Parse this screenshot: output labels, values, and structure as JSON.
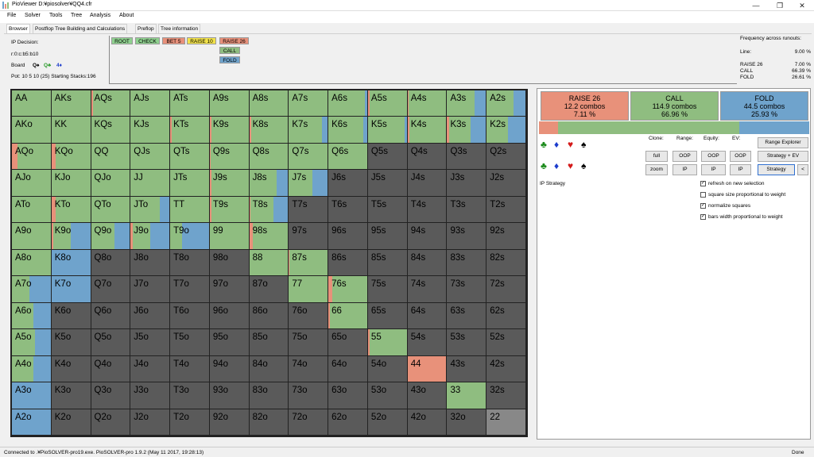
{
  "window": {
    "title": "PioViewer D:¥piosolver¥QQ4.cfr",
    "minimize": "—",
    "maximize": "❐",
    "close": "✕"
  },
  "menu": [
    "File",
    "Solver",
    "Tools",
    "Tree",
    "Analysis",
    "About"
  ],
  "tabs": [
    "Browser",
    "Postflop Tree Building and Calculations",
    "Preflop",
    "Tree information"
  ],
  "info": {
    "decision": "IP Decision:",
    "line": "r:0:c:b5:b10",
    "board_label": "Board",
    "board_cards": [
      {
        "text": "Q♠",
        "color": "#000000"
      },
      {
        "text": "Q♣",
        "color": "#2a9a2a"
      },
      {
        "text": "4♦",
        "color": "#1c3ccc"
      }
    ],
    "pot": "Pot: 10 5 10 (25) Starting Stacks:196"
  },
  "tree_buttons": [
    {
      "label": "ROOT",
      "color": "#8fd18f"
    },
    {
      "label": "CHECK",
      "color": "#8fd18f"
    },
    {
      "label": "BET 5",
      "color": "#e8907a"
    },
    {
      "label": "RAISE 10",
      "color": "#f2e24a"
    },
    {
      "label": "RAISE 26",
      "color": "#e8907a"
    },
    {
      "label": "CALL",
      "color": "#8fbd80"
    },
    {
      "label": "FOLD",
      "color": "#6fa3cc"
    }
  ],
  "frequency": {
    "title": "Frequency across runouts:",
    "line_label": "Line:",
    "line_value": "9.00 %",
    "rows": [
      {
        "label": "RAISE 26",
        "value": "7.00 %"
      },
      {
        "label": "CALL",
        "value": "66.39 %"
      },
      {
        "label": "FOLD",
        "value": "26.61 %"
      }
    ]
  },
  "colors": {
    "raise": "#e8917a",
    "call": "#8fbd80",
    "fold": "#6fa3cc",
    "empty": "#5a5a5a",
    "pair22": "#888888"
  },
  "grid": {
    "rows": [
      [
        "AA",
        "AKs",
        "AQs",
        "AJs",
        "ATs",
        "A9s",
        "A8s",
        "A7s",
        "A6s",
        "A5s",
        "A4s",
        "A3s",
        "A2s"
      ],
      [
        "AKo",
        "KK",
        "KQs",
        "KJs",
        "KTs",
        "K9s",
        "K8s",
        "K7s",
        "K6s",
        "K5s",
        "K4s",
        "K3s",
        "K2s"
      ],
      [
        "AQo",
        "KQo",
        "QQ",
        "QJs",
        "QTs",
        "Q9s",
        "Q8s",
        "Q7s",
        "Q6s",
        "Q5s",
        "Q4s",
        "Q3s",
        "Q2s"
      ],
      [
        "AJo",
        "KJo",
        "QJo",
        "JJ",
        "JTs",
        "J9s",
        "J8s",
        "J7s",
        "J6s",
        "J5s",
        "J4s",
        "J3s",
        "J2s"
      ],
      [
        "ATo",
        "KTo",
        "QTo",
        "JTo",
        "TT",
        "T9s",
        "T8s",
        "T7s",
        "T6s",
        "T5s",
        "T4s",
        "T3s",
        "T2s"
      ],
      [
        "A9o",
        "K9o",
        "Q9o",
        "J9o",
        "T9o",
        "99",
        "98s",
        "97s",
        "96s",
        "95s",
        "94s",
        "93s",
        "92s"
      ],
      [
        "A8o",
        "K8o",
        "Q8o",
        "J8o",
        "T8o",
        "98o",
        "88",
        "87s",
        "86s",
        "85s",
        "84s",
        "83s",
        "82s"
      ],
      [
        "A7o",
        "K7o",
        "Q7o",
        "J7o",
        "T7o",
        "97o",
        "87o",
        "77",
        "76s",
        "75s",
        "74s",
        "73s",
        "72s"
      ],
      [
        "A6o",
        "K6o",
        "Q6o",
        "J6o",
        "T6o",
        "96o",
        "86o",
        "76o",
        "66",
        "65s",
        "64s",
        "63s",
        "62s"
      ],
      [
        "A5o",
        "K5o",
        "Q5o",
        "J5o",
        "T5o",
        "95o",
        "85o",
        "75o",
        "65o",
        "55",
        "54s",
        "53s",
        "52s"
      ],
      [
        "A4o",
        "K4o",
        "Q4o",
        "J4o",
        "T4o",
        "94o",
        "84o",
        "74o",
        "64o",
        "54o",
        "44",
        "43s",
        "42s"
      ],
      [
        "A3o",
        "K3o",
        "Q3o",
        "J3o",
        "T3o",
        "93o",
        "83o",
        "73o",
        "63o",
        "53o",
        "43o",
        "33",
        "32s"
      ],
      [
        "A2o",
        "K2o",
        "Q2o",
        "J2o",
        "T2o",
        "92o",
        "82o",
        "72o",
        "62o",
        "52o",
        "42o",
        "32o",
        "22"
      ]
    ],
    "strategy": [
      [
        [
          0,
          1,
          0
        ],
        [
          0,
          1,
          0
        ],
        [
          0.05,
          0.95,
          0
        ],
        [
          0,
          1,
          0
        ],
        [
          0,
          1,
          0
        ],
        [
          0,
          1,
          0
        ],
        [
          0,
          1,
          0
        ],
        [
          0,
          1,
          0
        ],
        [
          0,
          0.95,
          0.05
        ],
        [
          0.05,
          0.95,
          0
        ],
        [
          0.02,
          0.98,
          0
        ],
        [
          0,
          0.7,
          0.3
        ],
        [
          0,
          0.7,
          0.3
        ]
      ],
      [
        [
          0,
          1,
          0
        ],
        [
          0,
          1,
          0
        ],
        [
          0,
          1,
          0
        ],
        [
          0,
          1,
          0
        ],
        [
          0.03,
          0.97,
          0
        ],
        [
          0.05,
          0.95,
          0
        ],
        [
          0.05,
          0.95,
          0
        ],
        [
          0,
          0.85,
          0.15
        ],
        [
          0,
          0.9,
          0.1
        ],
        [
          0,
          0.95,
          0.05
        ],
        [
          0.05,
          0.95,
          0
        ],
        [
          0.05,
          0.55,
          0.4
        ],
        [
          0,
          0.55,
          0.45
        ]
      ],
      [
        [
          0.15,
          0.85,
          0
        ],
        [
          0.1,
          0.9,
          0
        ],
        [
          0,
          1,
          0
        ],
        [
          0,
          1,
          0
        ],
        [
          0,
          1,
          0
        ],
        [
          0.03,
          0.97,
          0
        ],
        [
          0,
          1,
          0
        ],
        [
          0,
          1,
          0
        ],
        [
          0,
          1,
          0
        ],
        [
          0,
          0,
          0
        ],
        [
          0,
          0,
          0
        ],
        [
          0,
          0,
          0
        ],
        [
          0,
          0,
          0
        ]
      ],
      [
        [
          0,
          1,
          0
        ],
        [
          0,
          1,
          0
        ],
        [
          0,
          1,
          0
        ],
        [
          0,
          1,
          0
        ],
        [
          0,
          1,
          0
        ],
        [
          0.05,
          0.95,
          0
        ],
        [
          0,
          0.7,
          0.3
        ],
        [
          0,
          0.6,
          0.4
        ],
        [
          0,
          0,
          0
        ],
        [
          0,
          0,
          0
        ],
        [
          0,
          0,
          0
        ],
        [
          0,
          0,
          0
        ],
        [
          0,
          0,
          0
        ]
      ],
      [
        [
          0,
          1,
          0
        ],
        [
          0.1,
          0.9,
          0
        ],
        [
          0,
          1,
          0
        ],
        [
          0,
          0.75,
          0.25
        ],
        [
          0,
          1,
          0
        ],
        [
          0.05,
          0.95,
          0
        ],
        [
          0.02,
          0.6,
          0.38
        ],
        [
          0,
          0,
          0
        ],
        [
          0,
          0,
          0
        ],
        [
          0,
          0,
          0
        ],
        [
          0,
          0,
          0
        ],
        [
          0,
          0,
          0
        ],
        [
          0,
          0,
          0
        ]
      ],
      [
        [
          0,
          1,
          0
        ],
        [
          0.05,
          0.45,
          0.5
        ],
        [
          0,
          0.6,
          0.4
        ],
        [
          0.05,
          0.45,
          0.5
        ],
        [
          0,
          0.3,
          0.7
        ],
        [
          0,
          1,
          0
        ],
        [
          0.1,
          0.9,
          0
        ],
        [
          0,
          0,
          0
        ],
        [
          0,
          0,
          0
        ],
        [
          0,
          0,
          0
        ],
        [
          0,
          0,
          0
        ],
        [
          0,
          0,
          0
        ],
        [
          0,
          0,
          0
        ]
      ],
      [
        [
          0,
          1,
          0
        ],
        [
          0,
          0,
          1
        ],
        [
          0,
          0,
          0
        ],
        [
          0,
          0,
          0
        ],
        [
          0,
          0,
          0
        ],
        [
          0,
          0,
          0
        ],
        [
          0,
          1,
          0
        ],
        [
          0.02,
          0.98,
          0
        ],
        [
          0,
          0,
          0
        ],
        [
          0,
          0,
          0
        ],
        [
          0,
          0,
          0
        ],
        [
          0,
          0,
          0
        ],
        [
          0,
          0,
          0
        ]
      ],
      [
        [
          0,
          0.45,
          0.55
        ],
        [
          0,
          0,
          1
        ],
        [
          0,
          0,
          0
        ],
        [
          0,
          0,
          0
        ],
        [
          0,
          0,
          0
        ],
        [
          0,
          0,
          0
        ],
        [
          0,
          0,
          0
        ],
        [
          0,
          1,
          0
        ],
        [
          0.1,
          0.9,
          0
        ],
        [
          0,
          0,
          0
        ],
        [
          0,
          0,
          0
        ],
        [
          0,
          0,
          0
        ],
        [
          0,
          0,
          0
        ]
      ],
      [
        [
          0,
          0.55,
          0.45
        ],
        [
          0,
          0,
          0
        ],
        [
          0,
          0,
          0
        ],
        [
          0,
          0,
          0
        ],
        [
          0,
          0,
          0
        ],
        [
          0,
          0,
          0
        ],
        [
          0,
          0,
          0
        ],
        [
          0,
          0,
          0
        ],
        [
          0.04,
          0.96,
          0
        ],
        [
          0,
          0,
          0
        ],
        [
          0,
          0,
          0
        ],
        [
          0,
          0,
          0
        ],
        [
          0,
          0,
          0
        ]
      ],
      [
        [
          0,
          0.6,
          0.4
        ],
        [
          0,
          0,
          0
        ],
        [
          0,
          0,
          0
        ],
        [
          0,
          0,
          0
        ],
        [
          0,
          0,
          0
        ],
        [
          0,
          0,
          0
        ],
        [
          0,
          0,
          0
        ],
        [
          0,
          0,
          0
        ],
        [
          0,
          0,
          0
        ],
        [
          0.04,
          0.96,
          0
        ],
        [
          0,
          0,
          0
        ],
        [
          0,
          0,
          0
        ],
        [
          0,
          0,
          0
        ]
      ],
      [
        [
          0,
          0.55,
          0.45
        ],
        [
          0,
          0,
          0
        ],
        [
          0,
          0,
          0
        ],
        [
          0,
          0,
          0
        ],
        [
          0,
          0,
          0
        ],
        [
          0,
          0,
          0
        ],
        [
          0,
          0,
          0
        ],
        [
          0,
          0,
          0
        ],
        [
          0,
          0,
          0
        ],
        [
          0,
          0,
          0
        ],
        [
          1,
          0,
          0
        ],
        [
          0,
          0,
          0
        ],
        [
          0,
          0,
          0
        ]
      ],
      [
        [
          0,
          0,
          1
        ],
        [
          0,
          0,
          0
        ],
        [
          0,
          0,
          0
        ],
        [
          0,
          0,
          0
        ],
        [
          0,
          0,
          0
        ],
        [
          0,
          0,
          0
        ],
        [
          0,
          0,
          0
        ],
        [
          0,
          0,
          0
        ],
        [
          0,
          0,
          0
        ],
        [
          0,
          0,
          0
        ],
        [
          0,
          0,
          0
        ],
        [
          0,
          1,
          0
        ],
        [
          0,
          0,
          0
        ]
      ],
      [
        [
          0,
          0,
          1
        ],
        [
          0,
          0,
          0
        ],
        [
          0,
          0,
          0
        ],
        [
          0,
          0,
          0
        ],
        [
          0,
          0,
          0
        ],
        [
          0,
          0,
          0
        ],
        [
          0,
          0,
          0
        ],
        [
          0,
          0,
          0
        ],
        [
          0,
          0,
          0
        ],
        [
          0,
          0,
          0
        ],
        [
          0,
          0,
          0
        ],
        [
          0,
          0,
          0
        ],
        [
          0,
          0,
          0
        ]
      ]
    ]
  },
  "actions": [
    {
      "name": "RAISE 26",
      "combos": "12.2 combos",
      "pct": "7.11 %",
      "color": "#e8917a"
    },
    {
      "name": "CALL",
      "combos": "114.9 combos",
      "pct": "66.96 %",
      "color": "#8fbd80"
    },
    {
      "name": "FOLD",
      "combos": "44.5 combos",
      "pct": "25.93 %",
      "color": "#6fa3cc"
    }
  ],
  "freq_bar": [
    0.0711,
    0.6696,
    0.2593
  ],
  "suits": [
    {
      "g": "♣",
      "c": "#1a8a1a"
    },
    {
      "g": "♦",
      "c": "#1c3ccc"
    },
    {
      "g": "♥",
      "c": "#d41a1a"
    },
    {
      "g": "♠",
      "c": "#000000"
    }
  ],
  "controls": {
    "clone": "Clone:",
    "range": "Range:",
    "equity": "Equity:",
    "ev": "EV:",
    "full": "full",
    "zoom": "zoom",
    "oop": "OOP",
    "ip": "IP",
    "range_explorer": "Range Explorer",
    "strategy_ev": "Strategy + EV",
    "strategy": "Strategy",
    "nav": "<"
  },
  "ip_strategy": "IP Strategy",
  "checkboxes": [
    {
      "label": "refresh on new selection",
      "checked": true
    },
    {
      "label": "square size proportional to weight",
      "checked": false
    },
    {
      "label": "normalize squares",
      "checked": true
    },
    {
      "label": "bars width proportional to weight",
      "checked": true
    }
  ],
  "status": {
    "left": "Connected to .¥PioSOLVER-pro19.exe. PioSOLVER-pro 1.9.2 (May 11 2017, 19:28:13)",
    "right": "Done"
  }
}
